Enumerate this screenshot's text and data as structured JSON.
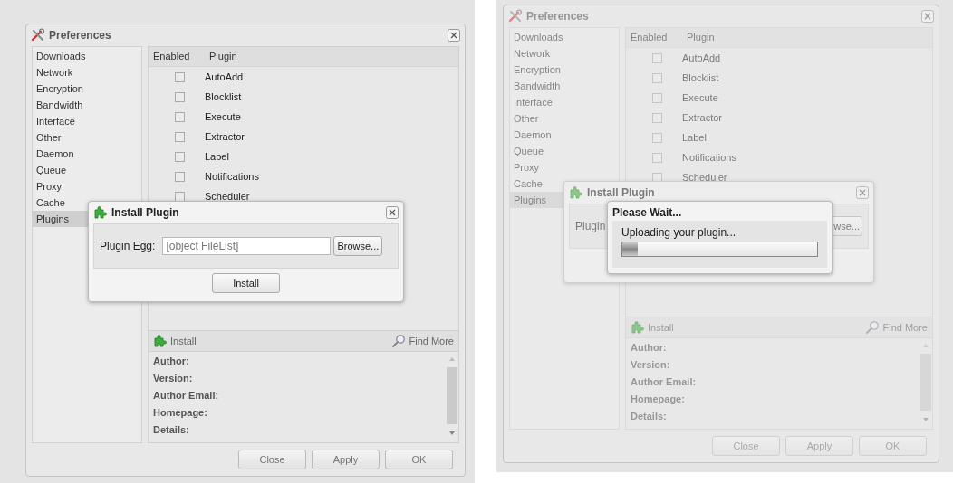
{
  "screens": [
    {
      "masked": false,
      "preferences": {
        "title": "Preferences",
        "sidebar": {
          "items": [
            {
              "label": "Downloads",
              "selected": false
            },
            {
              "label": "Network",
              "selected": false
            },
            {
              "label": "Encryption",
              "selected": false
            },
            {
              "label": "Bandwidth",
              "selected": false
            },
            {
              "label": "Interface",
              "selected": false
            },
            {
              "label": "Other",
              "selected": false
            },
            {
              "label": "Daemon",
              "selected": false
            },
            {
              "label": "Queue",
              "selected": false
            },
            {
              "label": "Proxy",
              "selected": false
            },
            {
              "label": "Cache",
              "selected": false
            },
            {
              "label": "Plugins",
              "selected": true
            }
          ]
        },
        "plugins_table": {
          "columns": [
            "Enabled",
            "Plugin"
          ],
          "rows": [
            {
              "name": "AutoAdd",
              "enabled": false
            },
            {
              "name": "Blocklist",
              "enabled": false
            },
            {
              "name": "Execute",
              "enabled": false
            },
            {
              "name": "Extractor",
              "enabled": false
            },
            {
              "name": "Label",
              "enabled": false
            },
            {
              "name": "Notifications",
              "enabled": false
            },
            {
              "name": "Scheduler",
              "enabled": false
            }
          ]
        },
        "toolbar": {
          "install": "Install",
          "find_more": "Find More"
        },
        "info_fields": [
          "Author:",
          "Version:",
          "Author Email:",
          "Homepage:",
          "Details:"
        ],
        "buttons": [
          "Close",
          "Apply",
          "OK"
        ]
      },
      "install_dialog": {
        "title": "Install Plugin",
        "label": "Plugin Egg:",
        "value": "[object FileList]",
        "browse": "Browse...",
        "install": "Install"
      }
    },
    {
      "masked": true,
      "preferences": {
        "title": "Preferences",
        "sidebar": {
          "items": [
            {
              "label": "Downloads",
              "selected": false
            },
            {
              "label": "Network",
              "selected": false
            },
            {
              "label": "Encryption",
              "selected": false
            },
            {
              "label": "Bandwidth",
              "selected": false
            },
            {
              "label": "Interface",
              "selected": false
            },
            {
              "label": "Other",
              "selected": false
            },
            {
              "label": "Daemon",
              "selected": false
            },
            {
              "label": "Queue",
              "selected": false
            },
            {
              "label": "Proxy",
              "selected": false
            },
            {
              "label": "Cache",
              "selected": false
            },
            {
              "label": "Plugins",
              "selected": true
            }
          ]
        },
        "plugins_table": {
          "columns": [
            "Enabled",
            "Plugin"
          ],
          "rows": [
            {
              "name": "AutoAdd",
              "enabled": false
            },
            {
              "name": "Blocklist",
              "enabled": false
            },
            {
              "name": "Execute",
              "enabled": false
            },
            {
              "name": "Extractor",
              "enabled": false
            },
            {
              "name": "Label",
              "enabled": false
            },
            {
              "name": "Notifications",
              "enabled": false
            },
            {
              "name": "Scheduler",
              "enabled": false
            }
          ]
        },
        "toolbar": {
          "install": "Install",
          "find_more": "Find More"
        },
        "info_fields": [
          "Author:",
          "Version:",
          "Author Email:",
          "Homepage:",
          "Details:"
        ],
        "buttons": [
          "Close",
          "Apply",
          "OK"
        ]
      },
      "install_dialog": {
        "title": "Install Plugin",
        "label": "Plugin",
        "browse": "wse..."
      },
      "wait_dialog": {
        "title": "Please Wait...",
        "message": "Uploading your plugin...",
        "level": 0.08
      }
    }
  ]
}
